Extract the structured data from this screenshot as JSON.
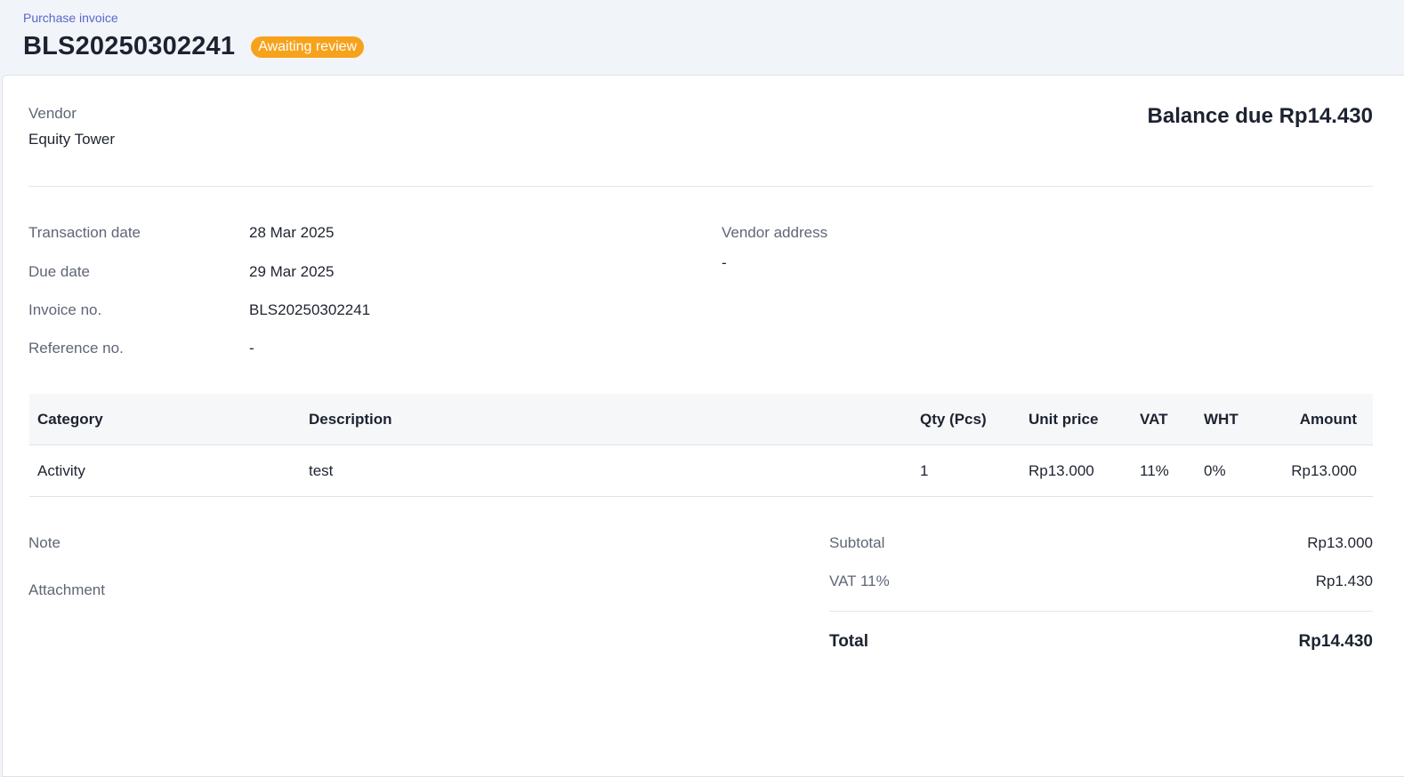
{
  "header": {
    "breadcrumb": "Purchase invoice",
    "title": "BLS20250302241",
    "status": "Awaiting review",
    "status_color": "#f7a21b"
  },
  "vendor": {
    "label": "Vendor",
    "name": "Equity Tower"
  },
  "balance_due": "Balance due Rp14.430",
  "details": {
    "transaction_date_label": "Transaction date",
    "transaction_date": "28 Mar 2025",
    "due_date_label": "Due date",
    "due_date": "29 Mar 2025",
    "invoice_no_label": "Invoice no.",
    "invoice_no": "BLS20250302241",
    "reference_no_label": "Reference no.",
    "reference_no": "-",
    "vendor_address_label": "Vendor address",
    "vendor_address": "-"
  },
  "table": {
    "columns": [
      "Category",
      "Description",
      "Qty (Pcs)",
      "Unit price",
      "VAT",
      "WHT",
      "Amount"
    ],
    "rows": [
      [
        "Activity",
        "test",
        "1",
        "Rp13.000",
        "11%",
        "0%",
        "Rp13.000"
      ]
    ]
  },
  "footer": {
    "note_label": "Note",
    "attachment_label": "Attachment",
    "subtotal_label": "Subtotal",
    "subtotal": "Rp13.000",
    "vat_label": "VAT 11%",
    "vat": "Rp1.430",
    "total_label": "Total",
    "total": "Rp14.430"
  }
}
